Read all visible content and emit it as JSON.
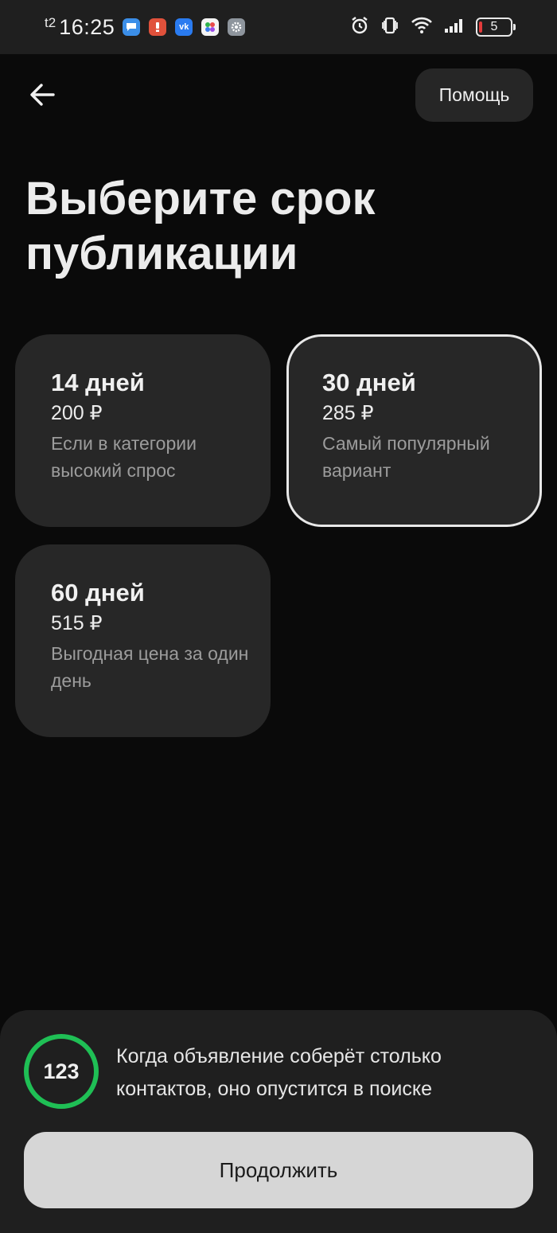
{
  "status_bar": {
    "carrier": "t2",
    "time": "16:25",
    "battery_level": "5",
    "notification_icons": [
      "messages-icon",
      "alert-app-icon",
      "vk-icon",
      "app-dots-icon",
      "settings-app-icon"
    ],
    "system_icons": [
      "alarm-icon",
      "vibrate-icon",
      "wifi-icon",
      "signal-icon",
      "battery-icon"
    ]
  },
  "header": {
    "back_icon": "arrow-left-icon",
    "help_label": "Помощь"
  },
  "title": "Выберите срок публикации",
  "plans": [
    {
      "days": "14 дней",
      "price": "200 ₽",
      "description": "Если в категории высокий спрос",
      "selected": false
    },
    {
      "days": "30 дней",
      "price": "285 ₽",
      "description": "Самый популярный вариант",
      "selected": true
    },
    {
      "days": "60 дней",
      "price": "515 ₽",
      "description": "Выгодная цена за один день",
      "selected": false
    }
  ],
  "footer": {
    "contacts_count": "123",
    "contacts_note": "Когда объявление соберёт столько контактов, оно опустится в поиске",
    "continue_label": "Продолжить"
  },
  "colors": {
    "background": "#0a0a0a",
    "card": "#272727",
    "accent_ring": "#1fbf55",
    "button": "#d6d6d6"
  }
}
